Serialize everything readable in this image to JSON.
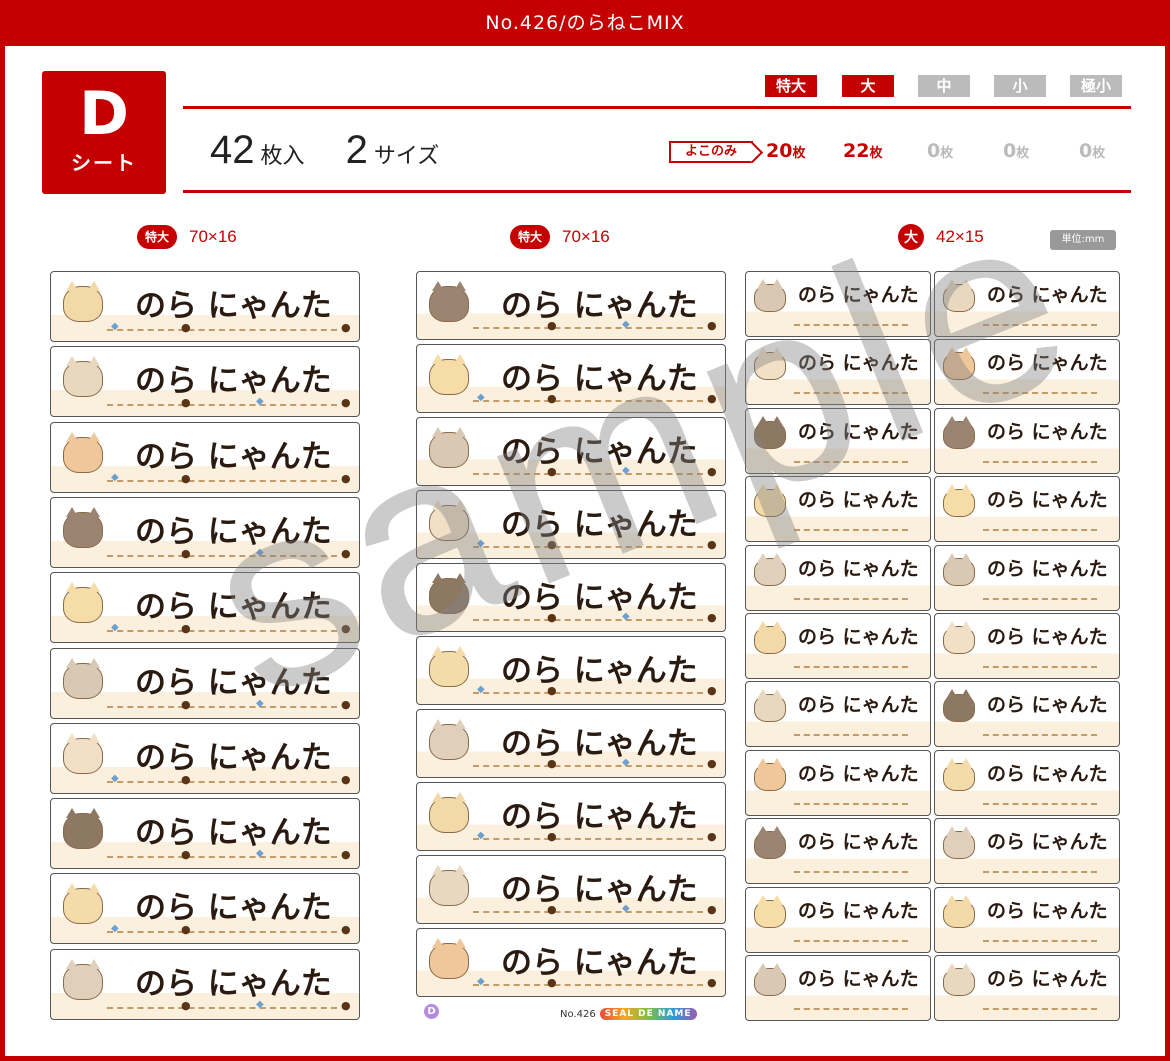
{
  "header": {
    "title": "No.426/のらねこMIX"
  },
  "sheet": {
    "letter": "D",
    "word": "シート"
  },
  "summary": {
    "count": "42",
    "count_unit": "枚入",
    "sizes": "2",
    "sizes_unit": "サイズ"
  },
  "size_tags": [
    {
      "label": "特大",
      "active": true
    },
    {
      "label": "大",
      "active": true
    },
    {
      "label": "中",
      "active": false
    },
    {
      "label": "小",
      "active": false
    },
    {
      "label": "極小",
      "active": false
    }
  ],
  "yoko_label": "よこのみ",
  "quantities": [
    {
      "value": "20",
      "unit": "枚",
      "active": true
    },
    {
      "value": "22",
      "unit": "枚",
      "active": true
    },
    {
      "value": "0",
      "unit": "枚",
      "active": false
    },
    {
      "value": "0",
      "unit": "枚",
      "active": false
    },
    {
      "value": "0",
      "unit": "枚",
      "active": false
    }
  ],
  "columns": [
    {
      "tag": "特大",
      "dims": "70×16"
    },
    {
      "tag": "特大",
      "dims": "70×16"
    },
    {
      "tag": "大",
      "dims": "42×15"
    }
  ],
  "unit_label": "単位:mm",
  "label_text": "のら にゃんた",
  "cat_colors": [
    "#f3d9a8",
    "#e8d8c0",
    "#f0c79a",
    "#9b8572",
    "#f6dca6",
    "#d9c9b4",
    "#f1e0c6",
    "#8d7864",
    "#f4dcaa",
    "#e0d0bb"
  ],
  "accent": "#c40000",
  "watermark": "sample",
  "footer": {
    "sheet_mark": "D",
    "number": "No.426",
    "brand": "SEAL DE NAME"
  }
}
